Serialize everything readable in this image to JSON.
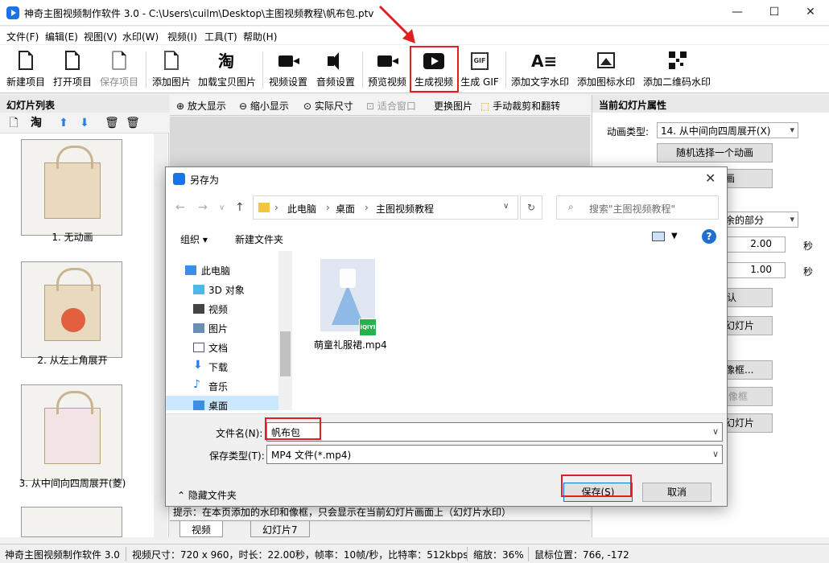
{
  "app": {
    "title": "神奇主图视频制作软件 3.0 - C:\\Users\\cuilm\\Desktop\\主图视频教程\\帆布包.ptv",
    "window_controls": [
      "—",
      "☐",
      "✕"
    ]
  },
  "menu": [
    "文件(F)",
    "编辑(E)",
    "视图(V)",
    "水印(W)",
    "视频(I)",
    "工具(T)",
    "帮助(H)"
  ],
  "toolbar": {
    "new_project": "新建项目",
    "open_project": "打开项目",
    "save_project": "保存项目",
    "add_image": "添加图片",
    "load_taobao": "加载宝贝图片",
    "video_settings": "视频设置",
    "audio_settings": "音频设置",
    "preview_video": "预览视频",
    "generate_video": "生成视频",
    "generate_gif": "生成 GIF",
    "add_text_watermark": "添加文字水印",
    "add_icon_watermark": "添加图标水印",
    "add_qr_watermark": "添加二维码水印",
    "gif_badge": "GIF",
    "taobao_glyph": "淘"
  },
  "slides_panel": {
    "title": "幻灯片列表",
    "taobao_glyph": "淘",
    "items": [
      {
        "caption": "1. 无动画"
      },
      {
        "caption": "2. 从左上角展开"
      },
      {
        "caption": "3. 从中间向四周展开(菱)"
      }
    ]
  },
  "center_toolbar": {
    "zoom_in": "放大显示",
    "zoom_out": "缩小显示",
    "actual_size": "实际尺寸",
    "fit_window": "适合窗口",
    "replace_image": "更换图片",
    "manual_crop": "手动裁剪和翻转"
  },
  "hint": "提示：在本页添加的水印和像框，只会显示在当前幻灯片画面上（幻灯片水印）",
  "tabs": [
    "视频",
    "幻灯片7"
  ],
  "properties": {
    "title": "当前幻灯片属性",
    "animation_type_label": "动画类型:",
    "animation_type_value": "14. 从中间向四周展开(X)",
    "random_button": "随机选择一个动画",
    "btn2": "画",
    "crop_select": "余的部分",
    "duration1": "2.00",
    "duration2": "1.00",
    "sec": "秒",
    "btn_confirm": "认",
    "btn_slide1": "幻灯片",
    "btn_frame": "像框...",
    "btn_frame2": "像框",
    "btn_slide2": "幻灯片"
  },
  "status": {
    "app": "神奇主图视频制作软件 3.0",
    "video_info": "视频尺寸：720 x 960，时长：22.00秒，帧率：10帧/秒，比特率：512kbps",
    "zoom": "缩放：36%",
    "mouse": "鼠标位置：766, -172"
  },
  "dialog": {
    "title": "另存为",
    "breadcrumb": [
      "此电脑",
      "桌面",
      "主图视频教程"
    ],
    "search_placeholder": "搜索\"主图视频教程\"",
    "organize": "组织 ▾",
    "new_folder": "新建文件夹",
    "help": "?",
    "nav": [
      "此电脑",
      "3D 对象",
      "视频",
      "图片",
      "文档",
      "下载",
      "音乐",
      "桌面"
    ],
    "file": {
      "name": "萌童礼服裙.mp4",
      "badge": "iQIYI"
    },
    "filename_label": "文件名(N):",
    "filename_value": "帆布包",
    "filetype_label": "保存类型(T):",
    "filetype_value": "MP4 文件(*.mp4)",
    "hide_folders": "隐藏文件夹",
    "save": "保存(S)",
    "cancel": "取消"
  },
  "colors": {
    "accent": "#1a73e8",
    "annotation": "#e02020"
  }
}
